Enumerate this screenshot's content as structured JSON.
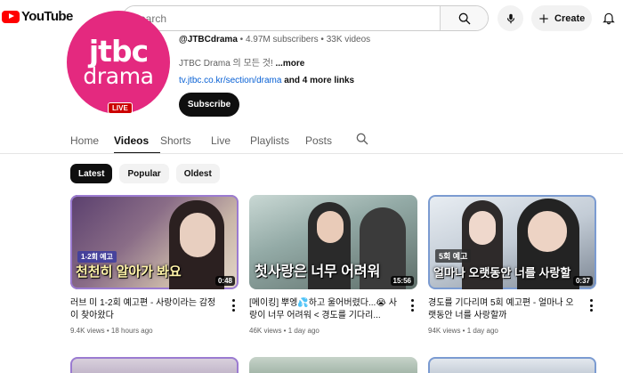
{
  "header": {
    "logo_text": "YouTube",
    "search_placeholder": "Search",
    "create_label": "Create"
  },
  "channel": {
    "avatar_line1": "jtbc",
    "avatar_line2": "drama",
    "live_badge": "LIVE",
    "handle": "@JTBCdrama",
    "stats": " • 4.97M subscribers • 33K videos",
    "description": "JTBC Drama 의 모든 것! ",
    "description_more": "...more",
    "link_url": "tv.jtbc.co.kr/section/drama",
    "link_more": " and 4 more links",
    "subscribe_label": "Subscribe"
  },
  "tabs": [
    {
      "label": "Home"
    },
    {
      "label": "Videos"
    },
    {
      "label": "Shorts"
    },
    {
      "label": "Live"
    },
    {
      "label": "Playlists"
    },
    {
      "label": "Posts"
    }
  ],
  "chips": [
    {
      "label": "Latest"
    },
    {
      "label": "Popular"
    },
    {
      "label": "Oldest"
    }
  ],
  "videos": [
    {
      "thumb_tag": "1-2회 예고",
      "thumb_text": "천천히 알아가 봐요",
      "duration": "0:48",
      "title": "러브 미 1-2회 예고편 - 사랑이라는 감정이 찾아왔다",
      "meta": "9.4K views • 18 hours ago"
    },
    {
      "thumb_tag": "",
      "thumb_text": "첫사랑은 너무 어려워",
      "duration": "15:56",
      "title": "[메이킹] 뿌엥💦하고 울어버렸다...😭 사랑이 너무 어려워 < 경도를 기다리...",
      "meta": "46K views • 1 day ago"
    },
    {
      "thumb_tag": "5회 예고",
      "thumb_text": "얼마나 오랫동안 너를 사랑할",
      "duration": "0:37",
      "title": "경도를 기다리며 5회 예고편 - 얼마나 오랫동안 너를 사랑할까",
      "meta": "94K views • 1 day ago"
    }
  ],
  "colors": {
    "brand_red": "#ff0000",
    "avatar_pink": "#e4297f",
    "link_blue": "#065fd4"
  }
}
